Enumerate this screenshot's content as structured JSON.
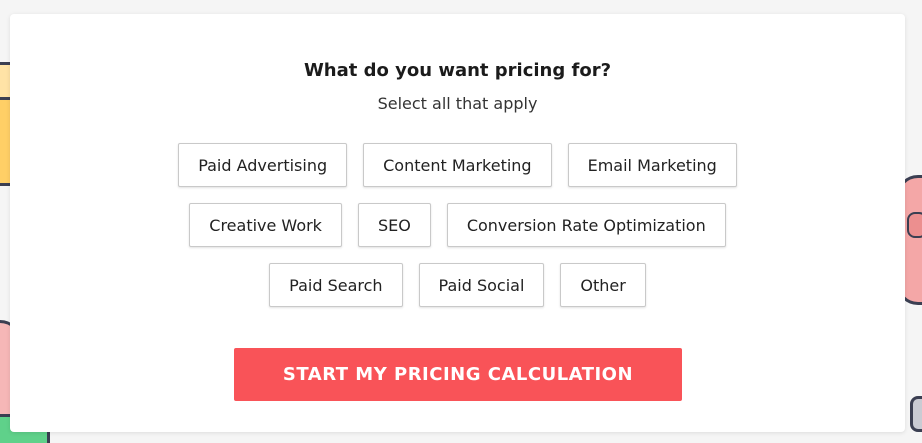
{
  "card": {
    "title": "What do you want pricing for?",
    "subtitle": "Select all that apply"
  },
  "options": {
    "row1": [
      "Paid Advertising",
      "Content Marketing",
      "Email Marketing"
    ],
    "row2": [
      "Creative Work",
      "SEO",
      "Conversion Rate Optimization"
    ],
    "row3": [
      "Paid Search",
      "Paid Social",
      "Other"
    ]
  },
  "cta": {
    "label": "START MY PRICING CALCULATION"
  },
  "colors": {
    "cta_background": "#f95358",
    "card_background": "#ffffff",
    "page_background": "#f5f5f5"
  }
}
